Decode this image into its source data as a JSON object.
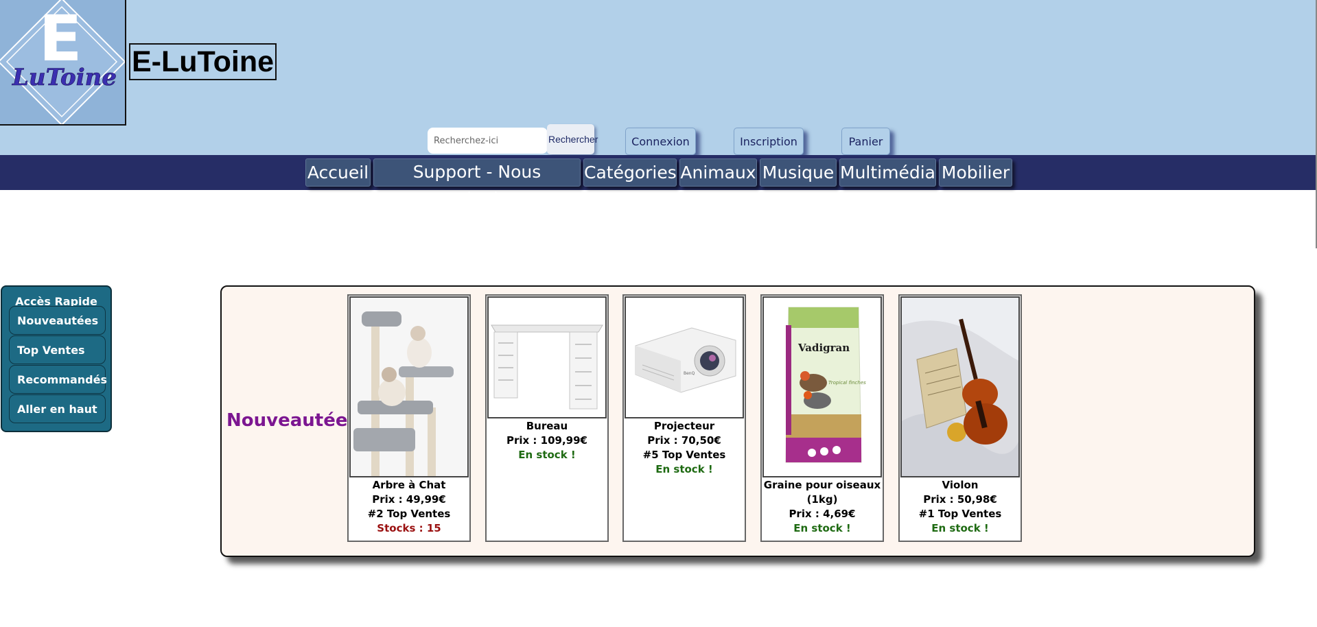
{
  "header": {
    "site_title": "E-LuToine",
    "logo_letter": "E",
    "logo_script": "LuToine",
    "search": {
      "placeholder": "Recherchez-ici",
      "value": "",
      "button_label": "Rechercher"
    },
    "buttons": {
      "login": "Connexion",
      "signup": "Inscription",
      "cart": "Panier"
    }
  },
  "nav": {
    "items": [
      "Accueil",
      "Support - Nous contacter",
      "Catégories",
      "Animaux",
      "Musique",
      "Multimédia",
      "Mobilier"
    ]
  },
  "quick_access": {
    "title": "Accès Rapide",
    "links": [
      "Nouveautées",
      "Top Ventes",
      "Recommandés",
      "Aller en haut"
    ]
  },
  "section": {
    "title": "Nouveautées",
    "products": [
      {
        "name": "Arbre à Chat",
        "price": "Prix : 49,99€",
        "rank": "#2 Top Ventes",
        "stock": "Stocks : 15",
        "stock_state": "low",
        "image_icon": "cat-tree-image"
      },
      {
        "name": "Bureau",
        "price": "Prix : 109,99€",
        "rank": "",
        "stock": "En stock !",
        "stock_state": "in",
        "image_icon": "desk-image"
      },
      {
        "name": "Projecteur",
        "price": "Prix : 70,50€",
        "rank": "#5 Top Ventes",
        "stock": "En stock !",
        "stock_state": "in",
        "image_icon": "projector-image",
        "image_brand": "BenQ"
      },
      {
        "name": "Graine pour oiseaux (1kg)",
        "price": "Prix : 4,69€",
        "rank": "",
        "stock": "En stock !",
        "stock_state": "in",
        "image_icon": "bird-seed-bag-image",
        "image_brand": "Vadigran",
        "image_caption": "Tropical finches"
      },
      {
        "name": "Violon",
        "price": "Prix : 50,98€",
        "rank": "#1 Top Ventes",
        "stock": "En stock !",
        "stock_state": "in",
        "image_icon": "violin-image"
      }
    ]
  },
  "colors": {
    "header_bg": "#b2d0e9",
    "navbar_bg": "#262d66",
    "quick_access_bg": "#1d6a84",
    "section_bg": "#fdf5ef",
    "section_title": "#7c1691",
    "in_stock": "#1e6a12",
    "low_stock": "#9a1010"
  }
}
